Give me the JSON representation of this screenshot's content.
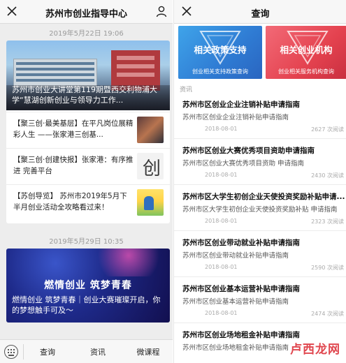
{
  "left": {
    "header": {
      "title": "苏州市创业指导中心"
    },
    "date1": "2019年5月22日 19:06",
    "hero1_caption": "苏州市创业大讲堂第119期暨西交利物浦大学“慧湖创新创业与领导力工作...",
    "articles": [
      {
        "text": "【聚三创·最美基层】在平凡岗位展精彩人生 ——张家港三创基..."
      },
      {
        "text": "【聚三创·创建快报】张家港：有序推进 完善平台"
      },
      {
        "text": "【苏创导览】 苏州市2019年5月下半月创业活动全攻略看过来！"
      }
    ],
    "thumb2_glyph": "创",
    "date2": "2019年5月29日 10:35",
    "hero2_slogan": "燃情创业  筑梦青春",
    "hero2_caption": "燃情创业  筑梦青春｜创业大赛璀璨开启，你的梦想触手可及～",
    "tabbar": {
      "tab1": "查询",
      "tab2": "资讯",
      "tab3": "微课程"
    }
  },
  "right": {
    "header": {
      "title": "查询"
    },
    "banners": [
      {
        "title": "相关政策支持",
        "subtitle": "创业相关支持政策查询",
        "color": "#2f7bd3"
      },
      {
        "title": "相关创业机构",
        "subtitle": "创业相关服务机构查询",
        "color": "#e4424f"
      }
    ],
    "section_label": "资讯",
    "articles": [
      {
        "title": "苏州市区创业企业注销补贴申请指南",
        "summary": "苏州市区创业企业注销补贴申请指南",
        "date": "2018-08-01",
        "views": "2627 次阅读"
      },
      {
        "title": "苏州市区创业大赛优秀项目资助申请指南",
        "summary": "苏州市区创业大赛优秀项目资助 申请指南",
        "date": "2018-08-01",
        "views": "2430 次阅读"
      },
      {
        "title": "苏州市区大学生初创企业天使投资奖励补贴申请...",
        "summary": "苏州市区大学生初创企业天使投资奖励补贴 申请指南",
        "date": "2018-08-01",
        "views": "2323 次阅读"
      },
      {
        "title": "苏州市区创业带动就业补贴申请指南",
        "summary": "苏州市区创业带动就业补贴申请指南",
        "date": "2018-08-01",
        "views": "2590 次阅读"
      },
      {
        "title": "苏州市区创业基本运营补贴申请指南",
        "summary": "苏州市区创业基本运营补贴申请指南",
        "date": "2018-08-01",
        "views": "2474 次阅读"
      },
      {
        "title": "苏州市区创业场地租金补贴申请指南",
        "summary": "苏州市区创业场地租金补贴申请指南",
        "date": "",
        "views": ""
      }
    ],
    "watermark": "卢西龙网"
  }
}
